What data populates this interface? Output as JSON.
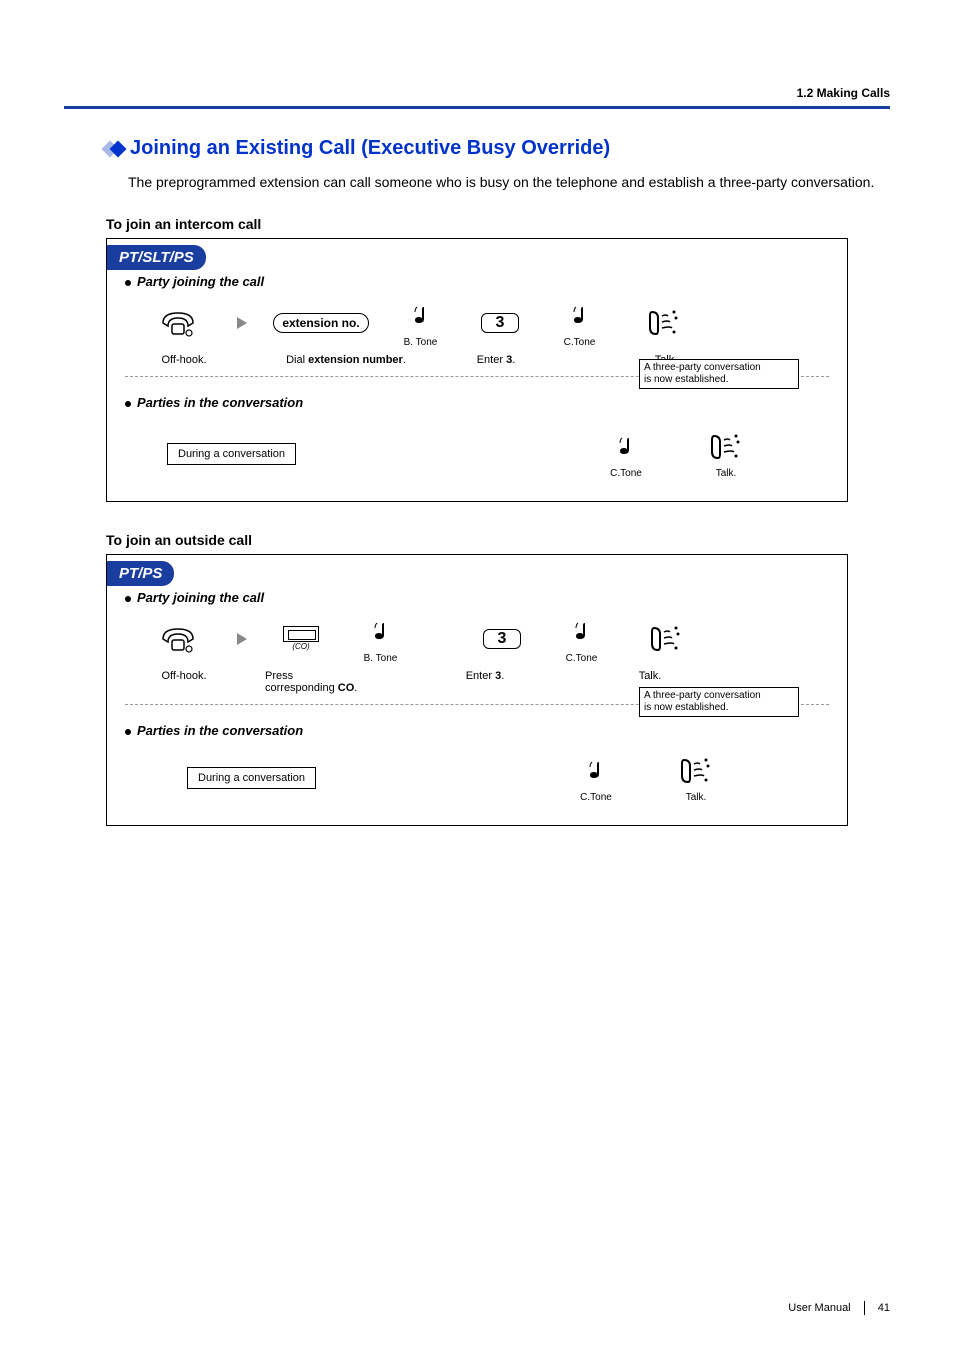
{
  "header": {
    "breadcrumb": "1.2 Making Calls"
  },
  "section": {
    "title": "Joining an Existing Call (Executive Busy Override)",
    "intro": "The preprogrammed extension can call someone who is busy on the telephone and establish a three-party conversation."
  },
  "intercom": {
    "subhead": "To join an intercom call",
    "device_label": "PT/SLT/PS",
    "joining_label": "Party joining the call",
    "parties_label": "Parties in the conversation",
    "steps": {
      "off_hook": "Off-hook.",
      "ext_key": "extension no.",
      "dial_pre": "Dial ",
      "dial_bold": "extension number",
      "dial_post": ".",
      "b_tone": "B. Tone",
      "key3": "3",
      "enter_pre": "Enter ",
      "enter_bold": "3",
      "enter_post": ".",
      "c_tone": "C.Tone",
      "talk": "Talk."
    },
    "note_line1": "A three-party conversation",
    "note_line2": "is now established.",
    "during": "During a conversation"
  },
  "outside": {
    "subhead": "To join an outside call",
    "device_label": "PT/PS",
    "joining_label": "Party joining the call",
    "parties_label": "Parties in the conversation",
    "steps": {
      "off_hook": "Off-hook.",
      "co_label": "(CO)",
      "press_pre": "Press",
      "press_line2a": "corresponding ",
      "press_line2b": "CO",
      "press_line2c": ".",
      "b_tone": "B. Tone",
      "key3": "3",
      "enter_pre": "Enter ",
      "enter_bold": "3",
      "enter_post": ".",
      "c_tone": "C.Tone",
      "talk": "Talk."
    },
    "note_line1": "A three-party conversation",
    "note_line2": "is now established.",
    "during": "During a conversation"
  },
  "footer": {
    "manual": "User Manual",
    "page": "41"
  }
}
